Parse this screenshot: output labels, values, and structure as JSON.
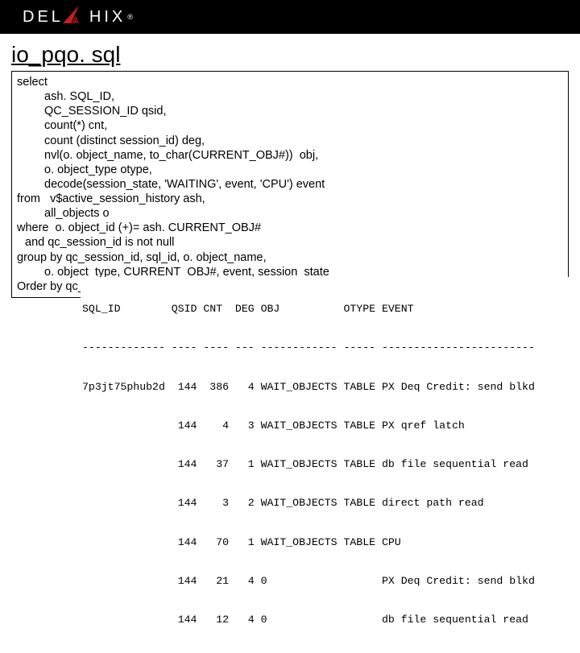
{
  "header": {
    "logo_left": "DEL",
    "logo_right": "HIX",
    "reg": "®"
  },
  "title": "io_pqo. sql",
  "sql": [
    "select",
    "ash. SQL_ID,",
    "QC_SESSION_ID qsid,",
    "count(*) cnt,",
    "count (distinct session_id) deg,",
    "nvl(o. object_name, to_char(CURRENT_OBJ#))  obj,",
    "o. object_type otype,",
    "decode(session_state, 'WAITING', event, 'CPU') event",
    "from   v$active_session_history ash,",
    "all_objects o",
    "where  o. object_id (+)= ash. CURRENT_OBJ#",
    "and qc_session_id is not null",
    "group by qc_session_id, sql_id, o. object_name,",
    "o. object_type, CURRENT_OBJ#, event, session_state",
    "Order by qc_session_id, sql_id"
  ],
  "table": {
    "headers": [
      "SQL_ID",
      "QSID",
      "CNT",
      "DEG",
      "OBJ",
      "OTYPE",
      "EVENT"
    ],
    "rows": [
      {
        "sql_id": "7p3jt75phub2d",
        "qsid": "144",
        "cnt": "386",
        "deg": "4",
        "obj": "WAIT_OBJECTS",
        "otype": "TABLE",
        "event": "PX Deq Credit: send blkd"
      },
      {
        "sql_id": "",
        "qsid": "144",
        "cnt": "4",
        "deg": "3",
        "obj": "WAIT_OBJECTS",
        "otype": "TABLE",
        "event": "PX qref latch"
      },
      {
        "sql_id": "",
        "qsid": "144",
        "cnt": "37",
        "deg": "1",
        "obj": "WAIT_OBJECTS",
        "otype": "TABLE",
        "event": "db file sequential read"
      },
      {
        "sql_id": "",
        "qsid": "144",
        "cnt": "3",
        "deg": "2",
        "obj": "WAIT_OBJECTS",
        "otype": "TABLE",
        "event": "direct path read"
      },
      {
        "sql_id": "",
        "qsid": "144",
        "cnt": "70",
        "deg": "1",
        "obj": "WAIT_OBJECTS",
        "otype": "TABLE",
        "event": "CPU"
      },
      {
        "sql_id": "",
        "qsid": "144",
        "cnt": "21",
        "deg": "4",
        "obj": "0",
        "otype": "",
        "event": "PX Deq Credit: send blkd"
      },
      {
        "sql_id": "",
        "qsid": "144",
        "cnt": "12",
        "deg": "4",
        "obj": "0",
        "otype": "",
        "event": "db file sequential read"
      }
    ]
  }
}
